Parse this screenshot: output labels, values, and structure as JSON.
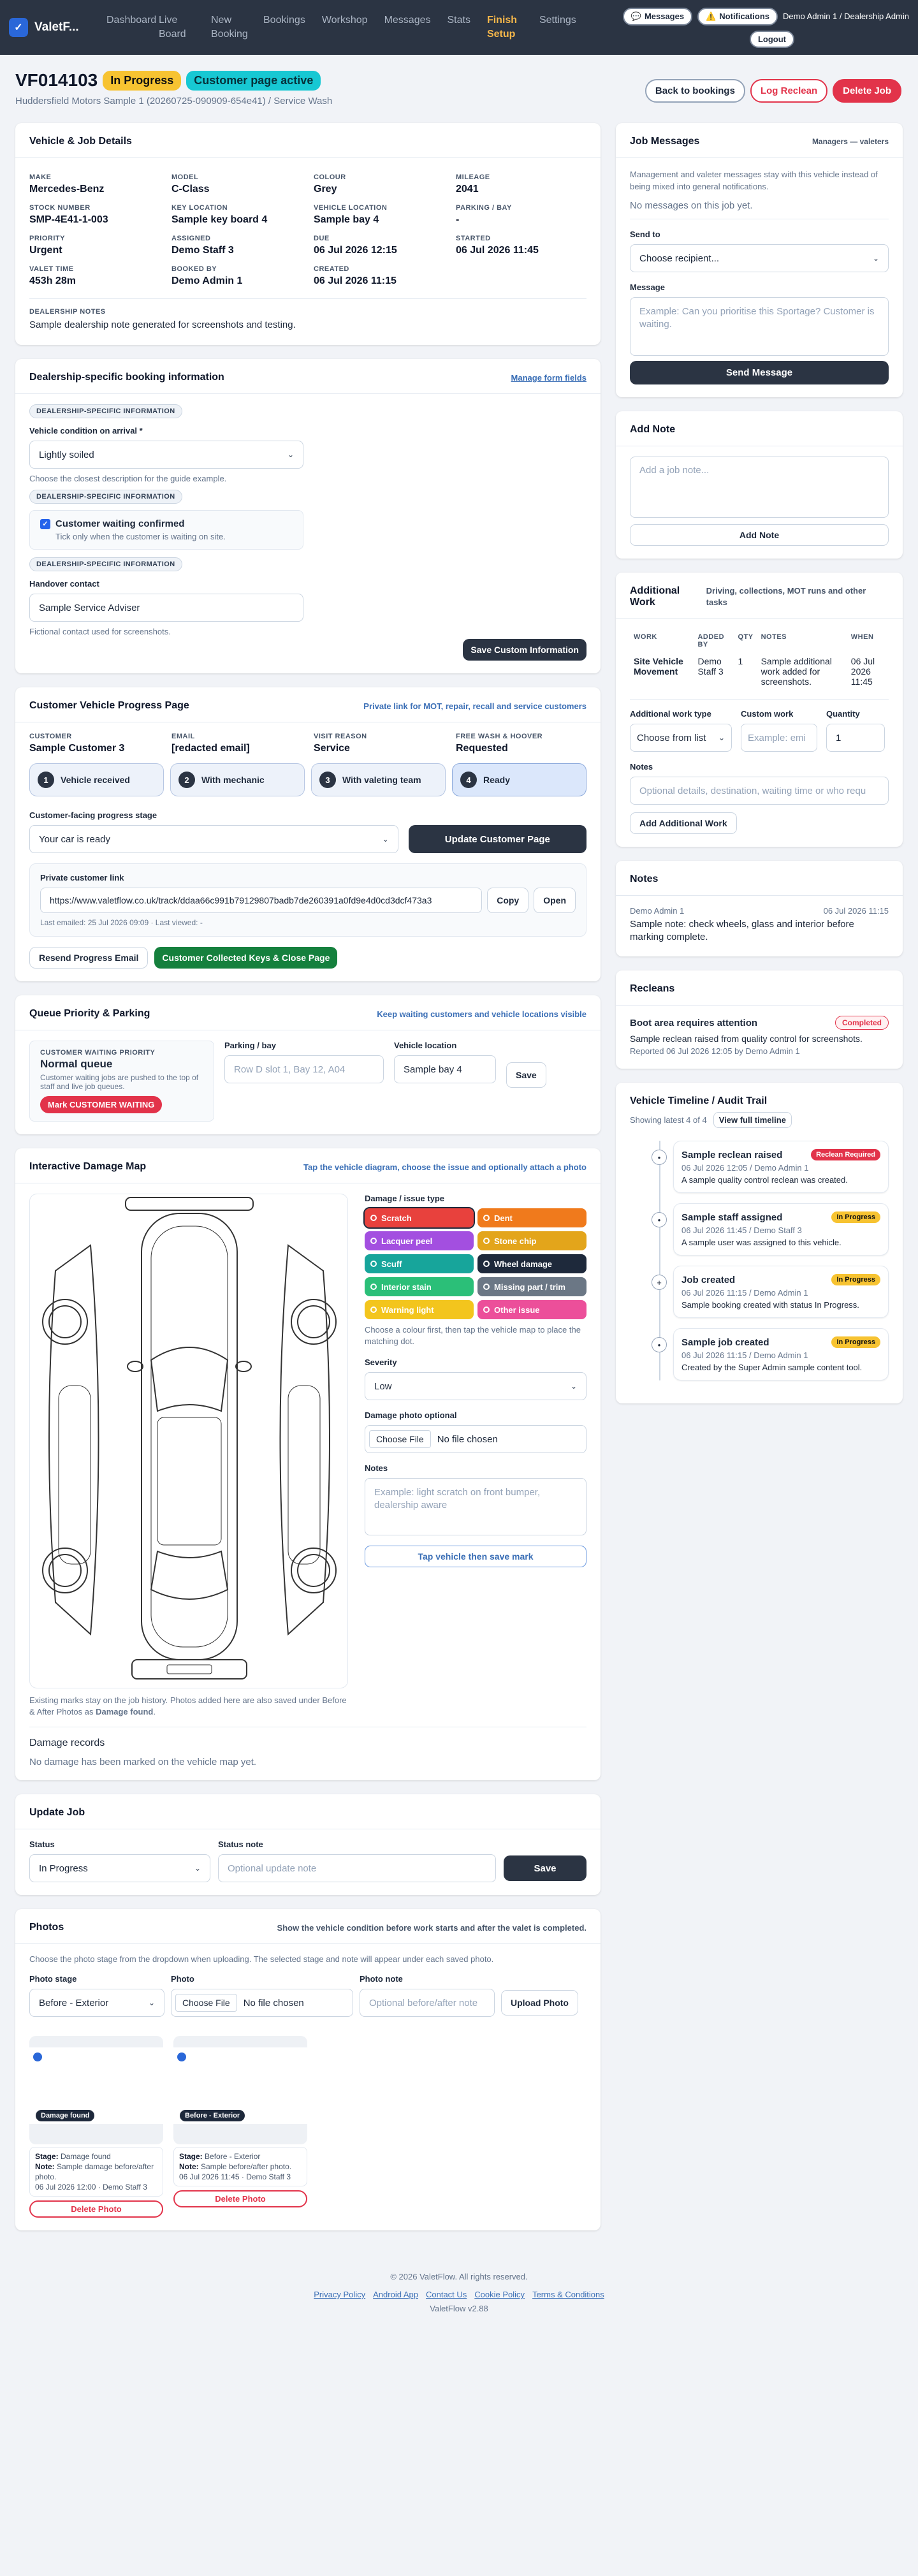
{
  "nav": {
    "brand": "ValetF...",
    "items": [
      {
        "label": "Dashboard",
        "active": false
      },
      {
        "label": "Live Board",
        "active": false
      },
      {
        "label": "New Booking",
        "active": false
      },
      {
        "label": "Bookings",
        "active": false
      },
      {
        "label": "Workshop",
        "active": false
      },
      {
        "label": "Messages",
        "active": false
      },
      {
        "label": "Stats",
        "active": false
      },
      {
        "label": "Finish Setup",
        "active": true
      },
      {
        "label": "Settings",
        "active": false
      }
    ],
    "messages": "Messages",
    "notifications": "Notifications",
    "user": "Demo Admin 1 / Dealership Admin",
    "logout": "Logout"
  },
  "header": {
    "ref": "VF014103",
    "status": "In Progress",
    "page_status": "Customer page active",
    "subtitle": "Huddersfield Motors Sample 1 (20260725-090909-654e41) / Service Wash",
    "back": "Back to bookings",
    "log_reclean": "Log Reclean",
    "delete": "Delete Job"
  },
  "vehicle": {
    "title": "Vehicle & Job Details",
    "fields": [
      {
        "label": "MAKE",
        "value": "Mercedes-Benz"
      },
      {
        "label": "MODEL",
        "value": "C-Class"
      },
      {
        "label": "COLOUR",
        "value": "Grey"
      },
      {
        "label": "MILEAGE",
        "value": "2041"
      },
      {
        "label": "STOCK NUMBER",
        "value": "SMP-4E41-1-003"
      },
      {
        "label": "KEY LOCATION",
        "value": "Sample key board 4"
      },
      {
        "label": "VEHICLE LOCATION",
        "value": "Sample bay 4"
      },
      {
        "label": "PARKING / BAY",
        "value": "-"
      },
      {
        "label": "PRIORITY",
        "value": "Urgent"
      },
      {
        "label": "ASSIGNED",
        "value": "Demo Staff 3"
      },
      {
        "label": "DUE",
        "value": "06 Jul 2026 12:15"
      },
      {
        "label": "STARTED",
        "value": "06 Jul 2026 11:45"
      },
      {
        "label": "VALET TIME",
        "value": "453h 28m"
      },
      {
        "label": "BOOKED BY",
        "value": "Demo Admin 1"
      },
      {
        "label": "CREATED",
        "value": "06 Jul 2026 11:15"
      }
    ],
    "notes_label": "DEALERSHIP NOTES",
    "notes": "Sample dealership note generated for screenshots and testing."
  },
  "dealer": {
    "title": "Dealership-specific booking information",
    "manage": "Manage form fields",
    "tag": "DEALERSHIP-SPECIFIC INFORMATION",
    "condition_label": "Vehicle condition on arrival *",
    "condition_value": "Lightly soiled",
    "condition_help": "Choose the closest description for the guide example.",
    "waiting_label": "Customer waiting confirmed",
    "waiting_help": "Tick only when the customer is waiting on site.",
    "handover_label": "Handover contact",
    "handover_value": "Sample Service Adviser",
    "handover_help": "Fictional contact used for screenshots.",
    "save": "Save Custom Information"
  },
  "progress": {
    "title": "Customer Vehicle Progress Page",
    "hint": "Private link for MOT, repair, recall and service customers",
    "fields": [
      {
        "label": "CUSTOMER",
        "value": "Sample Customer 3"
      },
      {
        "label": "EMAIL",
        "value": "[redacted email]"
      },
      {
        "label": "VISIT REASON",
        "value": "Service"
      },
      {
        "label": "FREE WASH & HOOVER",
        "value": "Requested"
      }
    ],
    "stages": [
      {
        "n": "1",
        "label": "Vehicle received"
      },
      {
        "n": "2",
        "label": "With mechanic"
      },
      {
        "n": "3",
        "label": "With valeting team"
      },
      {
        "n": "4",
        "label": "Ready"
      }
    ],
    "stage_label": "Customer-facing progress stage",
    "stage_value": "Your car is ready",
    "update": "Update Customer Page",
    "link_label": "Private customer link",
    "link": "https://www.valetflow.co.uk/track/ddaa66c991b79129807badb7de260391a0fd9e4d0cd3dcf473a3",
    "copy": "Copy",
    "open": "Open",
    "emailed": "Last emailed: 25 Jul 2026 09:09 · Last viewed: -",
    "resend": "Resend Progress Email",
    "collected": "Customer Collected Keys & Close Page"
  },
  "queue": {
    "title": "Queue Priority & Parking",
    "hint": "Keep waiting customers and vehicle locations visible",
    "prio_label": "CUSTOMER WAITING PRIORITY",
    "prio_value": "Normal queue",
    "prio_help": "Customer waiting jobs are pushed to the top of staff and live job queues.",
    "mark": "Mark CUSTOMER WAITING",
    "parking_label": "Parking / bay",
    "parking_ph": "Row D slot 1, Bay 12, A04",
    "location_label": "Vehicle location",
    "location_value": "Sample bay 4",
    "save": "Save"
  },
  "damage": {
    "title": "Interactive Damage Map",
    "hint": "Tap the vehicle diagram, choose the issue and optionally attach a photo",
    "type_label": "Damage / issue type",
    "types": [
      {
        "label": "Scratch",
        "color": "#e8413d"
      },
      {
        "label": "Dent",
        "color": "#f07a1c"
      },
      {
        "label": "Lacquer peel",
        "color": "#a34fe0"
      },
      {
        "label": "Stone chip",
        "color": "#e3a51b"
      },
      {
        "label": "Scuff",
        "color": "#17a59b"
      },
      {
        "label": "Wheel damage",
        "color": "#1e293b"
      },
      {
        "label": "Interior stain",
        "color": "#2bbf78"
      },
      {
        "label": "Missing part / trim",
        "color": "#6b7785"
      },
      {
        "label": "Warning light",
        "color": "#f3c51d"
      },
      {
        "label": "Other issue",
        "color": "#ec4f9a"
      }
    ],
    "type_help": "Choose a colour first, then tap the vehicle map to place the matching dot.",
    "severity_label": "Severity",
    "severity_value": "Low",
    "photo_label": "Damage photo optional",
    "choose": "Choose File",
    "nofile": "No file chosen",
    "notes_label": "Notes",
    "notes_ph": "Example: light scratch on front bumper, dealership aware",
    "tap": "Tap vehicle then save mark",
    "existing": "Existing marks stay on the job history. Photos added here are also saved under Before & After Photos as",
    "existing_bold": "Damage found",
    "records": "Damage records",
    "none": "No damage has been marked on the vehicle map yet."
  },
  "update": {
    "title": "Update Job",
    "status_label": "Status",
    "status_value": "In Progress",
    "note_label": "Status note",
    "note_ph": "Optional update note",
    "save": "Save"
  },
  "photos": {
    "title": "Photos",
    "hint": "Show the vehicle condition before work starts and after the valet is completed.",
    "help": "Choose the photo stage from the dropdown when uploading. The selected stage and note will appear under each saved photo.",
    "stage_label": "Photo stage",
    "stage_value": "Before - Exterior",
    "photo_label": "Photo",
    "choose": "Choose File",
    "nofile": "No file chosen",
    "note_label": "Photo note",
    "note_ph": "Optional before/after note",
    "upload": "Upload Photo",
    "items": [
      {
        "badge": "Damage found",
        "stage": "Damage found",
        "note": "Sample damage before/after photo.",
        "meta": "06 Jul 2026 12:00 · Demo Staff 3",
        "delete": "Delete Photo"
      },
      {
        "badge": "Before - Exterior",
        "stage": "Before - Exterior",
        "note": "Sample before/after photo.",
        "meta": "06 Jul 2026 11:45 · Demo Staff 3",
        "delete": "Delete Photo"
      }
    ]
  },
  "jobmsg": {
    "title": "Job Messages",
    "who": "Managers — valeters",
    "help": "Management and valeter messages stay with this vehicle instead of being mixed into general notifications.",
    "none": "No messages on this job yet.",
    "send_label": "Send to",
    "send_value": "Choose recipient...",
    "msg_label": "Message",
    "msg_ph": "Example: Can you prioritise this Sportage? Customer is waiting.",
    "send": "Send Message"
  },
  "addnote": {
    "title": "Add Note",
    "ph": "Add a job note...",
    "btn": "Add Note"
  },
  "additional": {
    "title": "Additional Work",
    "hint": "Driving, collections, MOT runs and other tasks",
    "cols": [
      "WORK",
      "ADDED BY",
      "QTY",
      "NOTES",
      "WHEN"
    ],
    "rows": [
      {
        "work": "Site Vehicle Movement",
        "by": "Demo Staff 3",
        "qty": "1",
        "notes": "Sample additional work added for screenshots.",
        "when": "06 Jul 2026 11:45"
      }
    ],
    "type_label": "Additional work type",
    "type_value": "Choose from list",
    "custom_label": "Custom work",
    "custom_ph": "Example: emi",
    "qty_label": "Quantity",
    "qty_value": "1",
    "notes_label": "Notes",
    "notes_ph": "Optional details, destination, waiting time or who requ",
    "btn": "Add Additional Work"
  },
  "notes": {
    "title": "Notes",
    "author": "Demo Admin 1",
    "date": "06 Jul 2026 11:15",
    "text": "Sample note: check wheels, glass and interior before marking complete."
  },
  "recleans": {
    "title": "Recleans",
    "heading": "Boot area requires attention",
    "badge": "Completed",
    "text": "Sample reclean raised from quality control for screenshots.",
    "meta": "Reported 06 Jul 2026 12:05 by Demo Admin 1"
  },
  "timeline": {
    "title": "Vehicle Timeline / Audit Trail",
    "showing": "Showing latest 4 of 4",
    "view": "View full timeline",
    "items": [
      {
        "icon": "•",
        "title": "Sample reclean raised",
        "badge": "Reclean Required",
        "badge_color": "#e2334a",
        "badge_text": "#fff",
        "meta": "06 Jul 2026 12:05 / Demo Admin 1",
        "text": "A sample quality control reclean was created."
      },
      {
        "icon": "•",
        "title": "Sample staff assigned",
        "badge": "In Progress",
        "badge_color": "#f7c331",
        "badge_text": "#111",
        "meta": "06 Jul 2026 11:45 / Demo Staff 3",
        "text": "A sample user was assigned to this vehicle."
      },
      {
        "icon": "+",
        "title": "Job created",
        "badge": "In Progress",
        "badge_color": "#f7c331",
        "badge_text": "#111",
        "meta": "06 Jul 2026 11:15 / Demo Admin 1",
        "text": "Sample booking created with status In Progress."
      },
      {
        "icon": "•",
        "title": "Sample job created",
        "badge": "In Progress",
        "badge_color": "#f7c331",
        "badge_text": "#111",
        "meta": "06 Jul 2026 11:15 / Demo Admin 1",
        "text": "Created by the Super Admin sample content tool."
      }
    ]
  },
  "footer": {
    "copy": "© 2026 ValetFlow. All rights reserved.",
    "links": [
      "Privacy Policy",
      "Android App",
      "Contact Us",
      "Cookie Policy",
      "Terms & Conditions"
    ],
    "version": "ValetFlow v2.88"
  }
}
